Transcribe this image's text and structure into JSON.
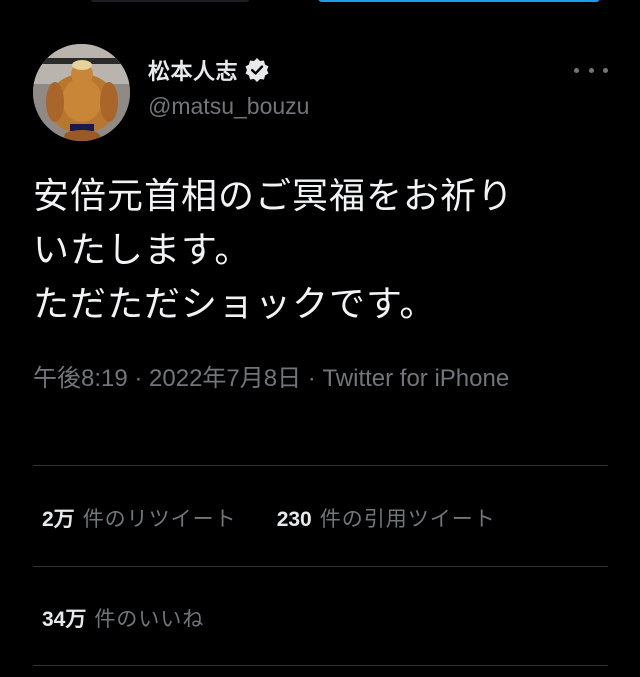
{
  "user": {
    "display_name": "松本人志",
    "handle": "@matsu_bouzu",
    "verified": true
  },
  "tweet": {
    "text": "安倍元首相のご冥福をお祈り\nいたします。\nただただショックです。",
    "meta": "午後8:19 · 2022年7月8日 · Twitter for iPhone"
  },
  "stats": {
    "retweets": {
      "count": "2万",
      "label": "件のリツイート"
    },
    "quotes": {
      "count": "230",
      "label": "件の引用ツイート"
    },
    "likes": {
      "count": "34万",
      "label": "件のいいね"
    }
  },
  "colors": {
    "background": "#000000",
    "text_primary": "#e7e9ea",
    "text_secondary": "#71767b",
    "divider": "#2f3336",
    "accent": "#1d9bf0"
  },
  "icons": {
    "verified": "verified-badge-icon",
    "more": "more-options-icon"
  }
}
